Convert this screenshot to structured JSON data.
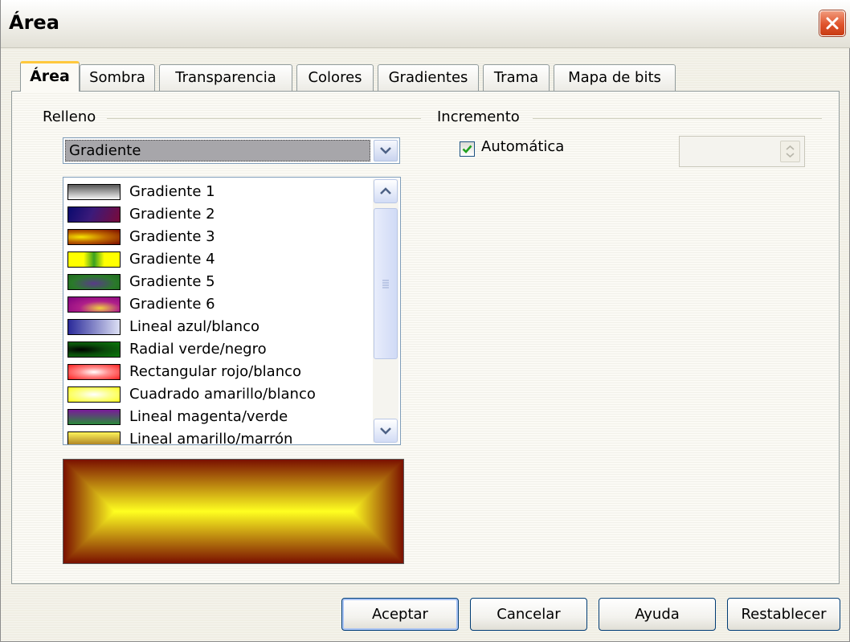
{
  "window": {
    "title": "Área"
  },
  "tabs": [
    {
      "label": "Área",
      "active": true
    },
    {
      "label": "Sombra"
    },
    {
      "label": "Transparencia"
    },
    {
      "label": "Colores"
    },
    {
      "label": "Gradientes"
    },
    {
      "label": "Trama"
    },
    {
      "label": "Mapa de bits"
    }
  ],
  "fill": {
    "group_label": "Relleno",
    "type_value": "Gradiente",
    "gradients": [
      {
        "label": "Gradiente 1"
      },
      {
        "label": "Gradiente 2"
      },
      {
        "label": "Gradiente 3"
      },
      {
        "label": "Gradiente 4"
      },
      {
        "label": "Gradiente 5"
      },
      {
        "label": "Gradiente 6"
      },
      {
        "label": "Lineal azul/blanco"
      },
      {
        "label": "Radial verde/negro"
      },
      {
        "label": "Rectangular rojo/blanco"
      },
      {
        "label": "Cuadrado amarillo/blanco"
      },
      {
        "label": "Lineal magenta/verde"
      },
      {
        "label": "Lineal amarillo/marrón"
      }
    ]
  },
  "increment": {
    "group_label": "Incremento",
    "auto_label": "Automática",
    "auto_checked": true
  },
  "buttons": {
    "ok": "Aceptar",
    "cancel": "Cancelar",
    "help": "Ayuda",
    "reset": "Restablecer"
  },
  "colors": {
    "accent_tab": "#ffc83c",
    "close_button": "#e0542c",
    "checkmark": "#21a121"
  }
}
